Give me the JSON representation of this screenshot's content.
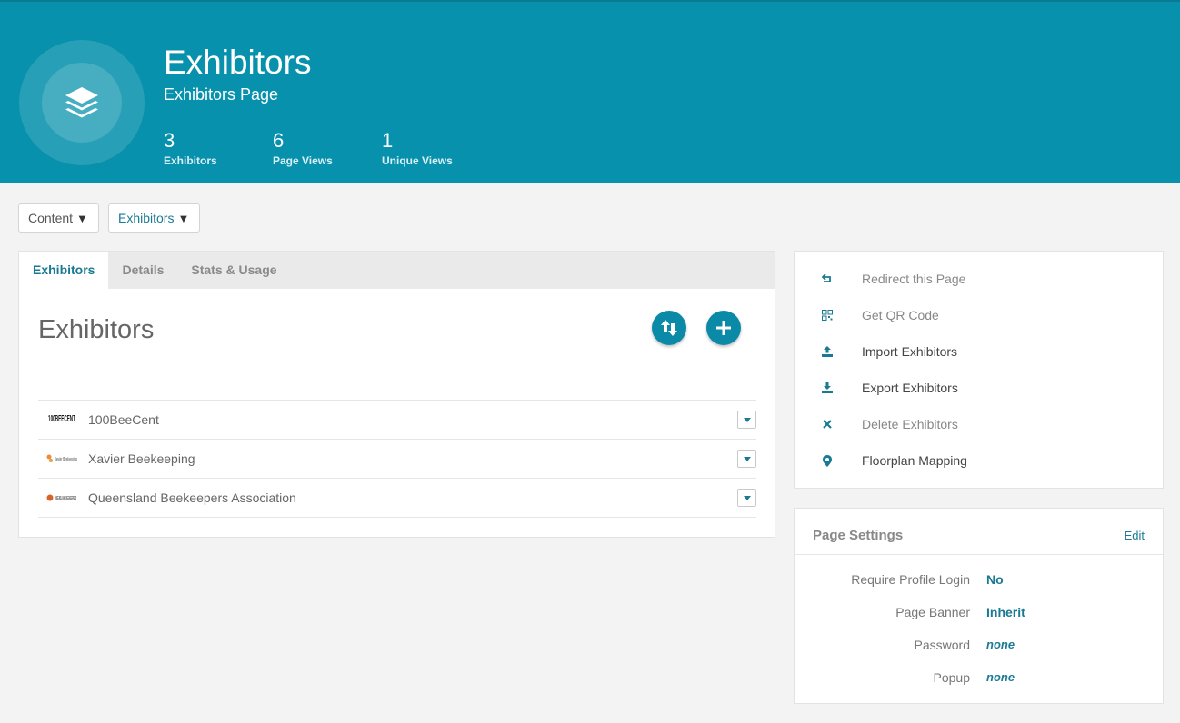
{
  "header": {
    "title": "Exhibitors",
    "subtitle": "Exhibitors Page",
    "stats": [
      {
        "value": "3",
        "label": "Exhibitors"
      },
      {
        "value": "6",
        "label": "Page Views"
      },
      {
        "value": "1",
        "label": "Unique Views"
      }
    ],
    "icon": "layers-icon"
  },
  "toolbar": {
    "content_label": "Content",
    "exhibitors_label": "Exhibitors",
    "caret": "▼"
  },
  "tabs": [
    {
      "label": "Exhibitors",
      "active": true
    },
    {
      "label": "Details",
      "active": false
    },
    {
      "label": "Stats & Usage",
      "active": false
    }
  ],
  "main": {
    "section_title": "Exhibitors",
    "exhibitors": [
      {
        "name": "100BeeCent",
        "logo_text": "100BEECENT"
      },
      {
        "name": "Xavier Beekeeping",
        "logo_text": "Xavier Beekeeping"
      },
      {
        "name": "Queensland Beekeepers Association",
        "logo_text": "QUEENSLAND BEEKEEPERS"
      }
    ]
  },
  "actions": [
    {
      "label": "Redirect this Page",
      "icon": "redirect-icon",
      "muted": true
    },
    {
      "label": "Get QR Code",
      "icon": "qr-code-icon",
      "muted": true
    },
    {
      "label": "Import Exhibitors",
      "icon": "upload-icon",
      "muted": false
    },
    {
      "label": "Export Exhibitors",
      "icon": "download-icon",
      "muted": false
    },
    {
      "label": "Delete Exhibitors",
      "icon": "close-icon",
      "muted": true
    },
    {
      "label": "Floorplan Mapping",
      "icon": "map-pin-icon",
      "muted": false
    }
  ],
  "settings": {
    "title": "Page Settings",
    "edit_label": "Edit",
    "rows": [
      {
        "key": "Require Profile Login",
        "value": "No"
      },
      {
        "key": "Page Banner",
        "value": "Inherit"
      },
      {
        "key": "Password",
        "value": "none"
      },
      {
        "key": "Popup",
        "value": "none"
      }
    ]
  },
  "colors": {
    "brand": "#0891ad",
    "accent": "#1a7a94",
    "background": "#f3f3f3"
  }
}
